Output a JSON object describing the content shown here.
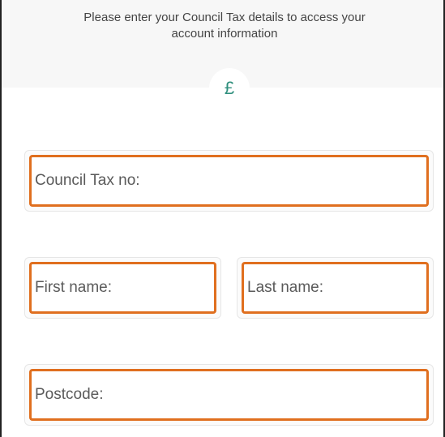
{
  "header": {
    "intro_line1": "Please enter your Council Tax details to access your",
    "intro_line2": "account information",
    "currency_symbol": "£"
  },
  "form": {
    "council_tax_no": {
      "placeholder": "Council Tax no:",
      "value": ""
    },
    "first_name": {
      "placeholder": "First name:",
      "value": ""
    },
    "last_name": {
      "placeholder": "Last name:",
      "value": ""
    },
    "postcode": {
      "placeholder": "Postcode:",
      "value": ""
    }
  },
  "colors": {
    "field_border": "#e06f1f",
    "icon": "#2f8f7d",
    "header_bg": "#f7f7f7"
  }
}
